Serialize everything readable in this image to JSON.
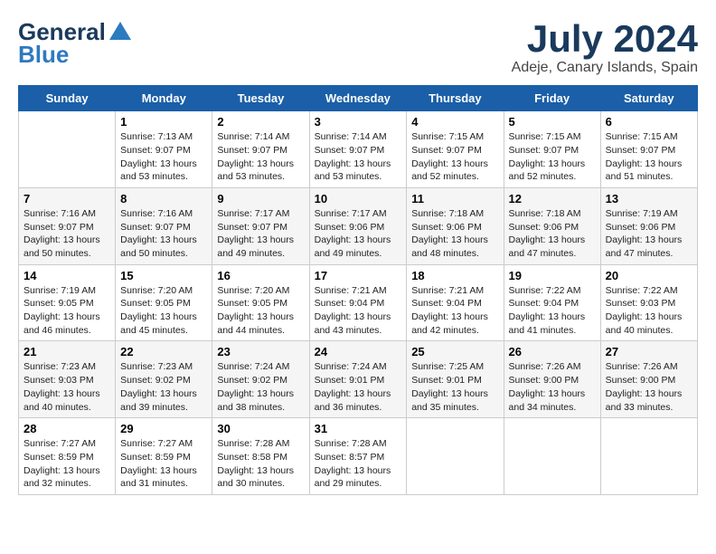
{
  "header": {
    "logo_line1": "General",
    "logo_line2": "Blue",
    "month": "July 2024",
    "location": "Adeje, Canary Islands, Spain"
  },
  "weekdays": [
    "Sunday",
    "Monday",
    "Tuesday",
    "Wednesday",
    "Thursday",
    "Friday",
    "Saturday"
  ],
  "weeks": [
    [
      {
        "day": "",
        "sunrise": "",
        "sunset": "",
        "daylight": ""
      },
      {
        "day": "1",
        "sunrise": "Sunrise: 7:13 AM",
        "sunset": "Sunset: 9:07 PM",
        "daylight": "Daylight: 13 hours and 53 minutes."
      },
      {
        "day": "2",
        "sunrise": "Sunrise: 7:14 AM",
        "sunset": "Sunset: 9:07 PM",
        "daylight": "Daylight: 13 hours and 53 minutes."
      },
      {
        "day": "3",
        "sunrise": "Sunrise: 7:14 AM",
        "sunset": "Sunset: 9:07 PM",
        "daylight": "Daylight: 13 hours and 53 minutes."
      },
      {
        "day": "4",
        "sunrise": "Sunrise: 7:15 AM",
        "sunset": "Sunset: 9:07 PM",
        "daylight": "Daylight: 13 hours and 52 minutes."
      },
      {
        "day": "5",
        "sunrise": "Sunrise: 7:15 AM",
        "sunset": "Sunset: 9:07 PM",
        "daylight": "Daylight: 13 hours and 52 minutes."
      },
      {
        "day": "6",
        "sunrise": "Sunrise: 7:15 AM",
        "sunset": "Sunset: 9:07 PM",
        "daylight": "Daylight: 13 hours and 51 minutes."
      }
    ],
    [
      {
        "day": "7",
        "sunrise": "Sunrise: 7:16 AM",
        "sunset": "Sunset: 9:07 PM",
        "daylight": "Daylight: 13 hours and 50 minutes."
      },
      {
        "day": "8",
        "sunrise": "Sunrise: 7:16 AM",
        "sunset": "Sunset: 9:07 PM",
        "daylight": "Daylight: 13 hours and 50 minutes."
      },
      {
        "day": "9",
        "sunrise": "Sunrise: 7:17 AM",
        "sunset": "Sunset: 9:07 PM",
        "daylight": "Daylight: 13 hours and 49 minutes."
      },
      {
        "day": "10",
        "sunrise": "Sunrise: 7:17 AM",
        "sunset": "Sunset: 9:06 PM",
        "daylight": "Daylight: 13 hours and 49 minutes."
      },
      {
        "day": "11",
        "sunrise": "Sunrise: 7:18 AM",
        "sunset": "Sunset: 9:06 PM",
        "daylight": "Daylight: 13 hours and 48 minutes."
      },
      {
        "day": "12",
        "sunrise": "Sunrise: 7:18 AM",
        "sunset": "Sunset: 9:06 PM",
        "daylight": "Daylight: 13 hours and 47 minutes."
      },
      {
        "day": "13",
        "sunrise": "Sunrise: 7:19 AM",
        "sunset": "Sunset: 9:06 PM",
        "daylight": "Daylight: 13 hours and 47 minutes."
      }
    ],
    [
      {
        "day": "14",
        "sunrise": "Sunrise: 7:19 AM",
        "sunset": "Sunset: 9:05 PM",
        "daylight": "Daylight: 13 hours and 46 minutes."
      },
      {
        "day": "15",
        "sunrise": "Sunrise: 7:20 AM",
        "sunset": "Sunset: 9:05 PM",
        "daylight": "Daylight: 13 hours and 45 minutes."
      },
      {
        "day": "16",
        "sunrise": "Sunrise: 7:20 AM",
        "sunset": "Sunset: 9:05 PM",
        "daylight": "Daylight: 13 hours and 44 minutes."
      },
      {
        "day": "17",
        "sunrise": "Sunrise: 7:21 AM",
        "sunset": "Sunset: 9:04 PM",
        "daylight": "Daylight: 13 hours and 43 minutes."
      },
      {
        "day": "18",
        "sunrise": "Sunrise: 7:21 AM",
        "sunset": "Sunset: 9:04 PM",
        "daylight": "Daylight: 13 hours and 42 minutes."
      },
      {
        "day": "19",
        "sunrise": "Sunrise: 7:22 AM",
        "sunset": "Sunset: 9:04 PM",
        "daylight": "Daylight: 13 hours and 41 minutes."
      },
      {
        "day": "20",
        "sunrise": "Sunrise: 7:22 AM",
        "sunset": "Sunset: 9:03 PM",
        "daylight": "Daylight: 13 hours and 40 minutes."
      }
    ],
    [
      {
        "day": "21",
        "sunrise": "Sunrise: 7:23 AM",
        "sunset": "Sunset: 9:03 PM",
        "daylight": "Daylight: 13 hours and 40 minutes."
      },
      {
        "day": "22",
        "sunrise": "Sunrise: 7:23 AM",
        "sunset": "Sunset: 9:02 PM",
        "daylight": "Daylight: 13 hours and 39 minutes."
      },
      {
        "day": "23",
        "sunrise": "Sunrise: 7:24 AM",
        "sunset": "Sunset: 9:02 PM",
        "daylight": "Daylight: 13 hours and 38 minutes."
      },
      {
        "day": "24",
        "sunrise": "Sunrise: 7:24 AM",
        "sunset": "Sunset: 9:01 PM",
        "daylight": "Daylight: 13 hours and 36 minutes."
      },
      {
        "day": "25",
        "sunrise": "Sunrise: 7:25 AM",
        "sunset": "Sunset: 9:01 PM",
        "daylight": "Daylight: 13 hours and 35 minutes."
      },
      {
        "day": "26",
        "sunrise": "Sunrise: 7:26 AM",
        "sunset": "Sunset: 9:00 PM",
        "daylight": "Daylight: 13 hours and 34 minutes."
      },
      {
        "day": "27",
        "sunrise": "Sunrise: 7:26 AM",
        "sunset": "Sunset: 9:00 PM",
        "daylight": "Daylight: 13 hours and 33 minutes."
      }
    ],
    [
      {
        "day": "28",
        "sunrise": "Sunrise: 7:27 AM",
        "sunset": "Sunset: 8:59 PM",
        "daylight": "Daylight: 13 hours and 32 minutes."
      },
      {
        "day": "29",
        "sunrise": "Sunrise: 7:27 AM",
        "sunset": "Sunset: 8:59 PM",
        "daylight": "Daylight: 13 hours and 31 minutes."
      },
      {
        "day": "30",
        "sunrise": "Sunrise: 7:28 AM",
        "sunset": "Sunset: 8:58 PM",
        "daylight": "Daylight: 13 hours and 30 minutes."
      },
      {
        "day": "31",
        "sunrise": "Sunrise: 7:28 AM",
        "sunset": "Sunset: 8:57 PM",
        "daylight": "Daylight: 13 hours and 29 minutes."
      },
      {
        "day": "",
        "sunrise": "",
        "sunset": "",
        "daylight": ""
      },
      {
        "day": "",
        "sunrise": "",
        "sunset": "",
        "daylight": ""
      },
      {
        "day": "",
        "sunrise": "",
        "sunset": "",
        "daylight": ""
      }
    ]
  ]
}
